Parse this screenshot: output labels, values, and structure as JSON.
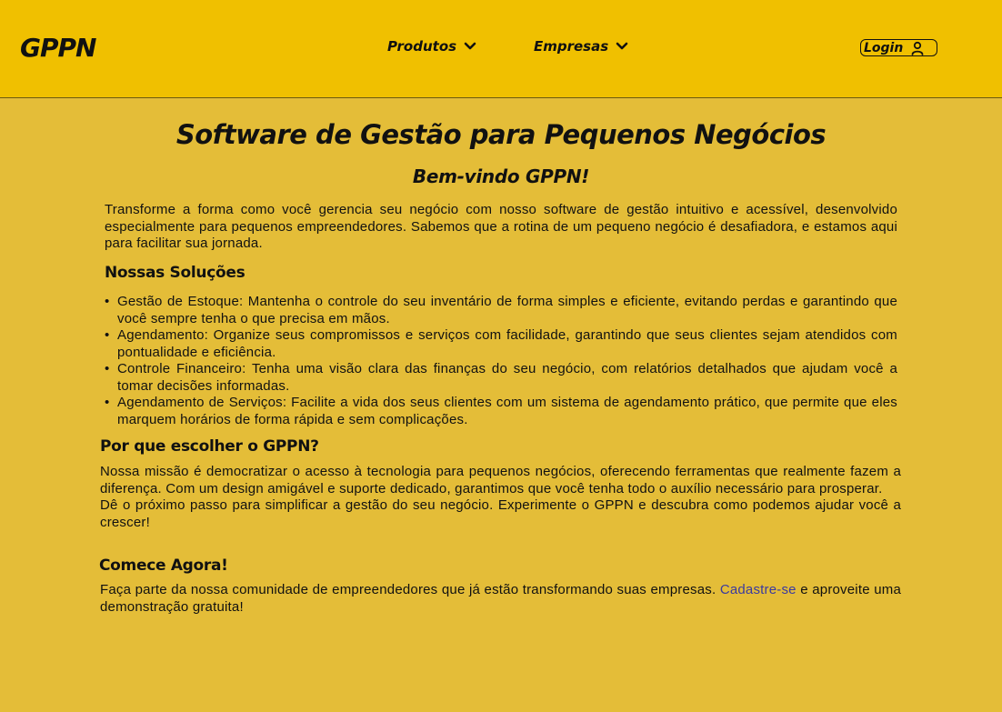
{
  "header": {
    "logo": "GPPN",
    "nav": [
      {
        "label": "Produtos"
      },
      {
        "label": "Empresas"
      }
    ],
    "login_label": "Login"
  },
  "main": {
    "title": "Software de Gestão para Pequenos Negócios",
    "subtitle": "Bem-vindo GPPN!",
    "intro": "Transforme a forma como você gerencia seu negócio com nosso software de gestão intuitivo e acessível, desenvolvido especialmente para pequenos empreendedores. Sabemos que a rotina de um pequeno negócio é desafiadora, e estamos aqui para facilitar sua jornada.",
    "solutions_heading": "Nossas Soluções",
    "solutions": [
      "Gestão de Estoque: Mantenha o controle do seu inventário de forma simples e eficiente, evitando perdas e garantindo que você sempre tenha o que precisa em mãos.",
      "Agendamento: Organize seus compromissos e serviços com facilidade, garantindo que seus clientes sejam atendidos com pontualidade e eficiência.",
      "Controle Financeiro: Tenha uma visão clara das finanças do seu negócio, com relatórios detalhados que ajudam você a tomar decisões informadas.",
      "Agendamento de Serviços: Facilite a vida dos seus clientes com um sistema de agendamento prático, que permite que eles marquem horários de forma rápida e sem complicações."
    ],
    "why_heading": "Por que escolher o GPPN?",
    "why_p1": "Nossa missão é democratizar o acesso à tecnologia para pequenos negócios, oferecendo ferramentas que realmente fazem a diferença. Com um design amigável e suporte dedicado, garantimos que você tenha todo o auxílio necessário para prosperar.",
    "why_p2": "Dê o próximo passo para simplificar a gestão do seu negócio. Experimente o GPPN e descubra como podemos ajudar você a crescer!",
    "start_heading": "Comece Agora!",
    "start_text_before": "Faça parte da nossa comunidade de empreendedores que já estão transformando suas empresas. ",
    "start_link": "Cadastre-se",
    "start_text_after": " e aproveite uma demonstração gratuita!"
  },
  "colors": {
    "header_bg": "#f0c000",
    "page_bg": "#e4bd38",
    "link": "#3a3aa0"
  }
}
